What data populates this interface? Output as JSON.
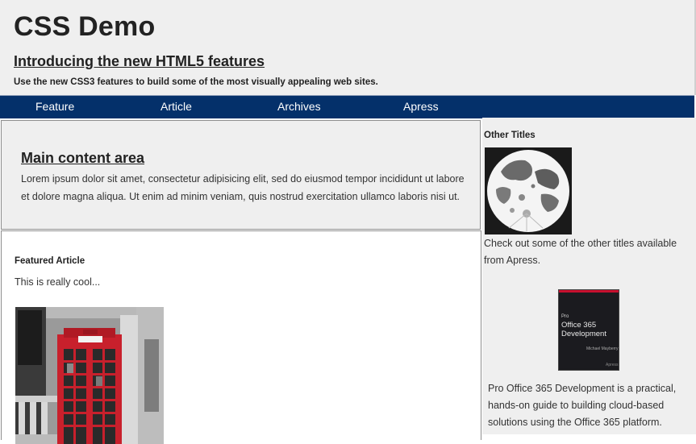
{
  "header": {
    "title": "CSS Demo",
    "subtitle": "Introducing the new HTML5 features",
    "tagline": "Use the new CSS3 features to build some of the most visually appealing web sites."
  },
  "nav": {
    "items": [
      {
        "label": "Feature"
      },
      {
        "label": "Article"
      },
      {
        "label": "Archives"
      },
      {
        "label": "Apress"
      }
    ]
  },
  "main": {
    "heading": "Main content area",
    "text": "Lorem ipsum dolor sit amet, consectetur adipisicing elit, sed do eiusmod tempor incididunt ut labore et dolore magna aliqua. Ut enim ad minim veniam, quis nostrud exercitation ullamco laboris nisi ut."
  },
  "featured": {
    "heading": "Featured Article",
    "text": "This is really cool..."
  },
  "sidebar": {
    "heading": "Other Titles",
    "text": "Check out some of the other titles available from Apress.",
    "book": {
      "series": "Pro",
      "title": "Office 365 Development",
      "author": "Michael Mayberry",
      "publisher": "Apress"
    },
    "description": "Pro Office 365 Development is a practical, hands-on guide to building cloud-based solutions using the Office 365 platform."
  },
  "colors": {
    "nav_background": "#04306a",
    "header_background": "#efefef",
    "phone_booth_red": "#c8202c"
  }
}
